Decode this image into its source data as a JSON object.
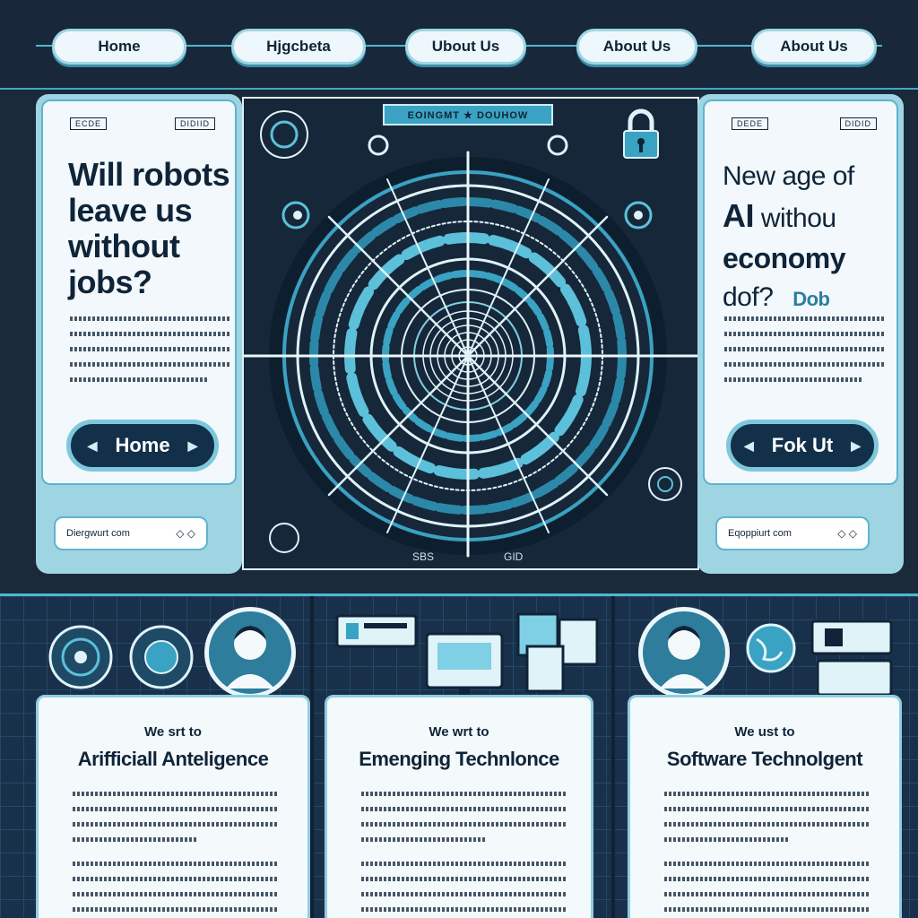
{
  "nav": {
    "items": [
      {
        "label": "Home"
      },
      {
        "label": "Hjgcbeta"
      },
      {
        "label": "Ubout Us"
      },
      {
        "label": "About Us"
      },
      {
        "label": "About Us"
      }
    ]
  },
  "left_card": {
    "tag_left": "ECDE",
    "tag_right": "DIDIID",
    "headline": "Will robots leave us without jobs?",
    "button_label": "Home",
    "email": "Diergwurt com"
  },
  "right_card": {
    "tag_left": "DEDE",
    "tag_right": "DIDID",
    "headline_line1": "New age of",
    "headline_ai": "AI",
    "headline_without": "withou",
    "headline_line3": "economy",
    "headline_line4": "dof?",
    "headline_accent": "Dob",
    "button_label": "Fok Ut",
    "email": "Eqoppiurt com"
  },
  "center": {
    "banner": "EOINGMT ★ DOUHOW",
    "label_left": "SBS",
    "label_right": "GID"
  },
  "cards": [
    {
      "subtitle": "We srt to",
      "title": "Arifficiall Anteligence"
    },
    {
      "subtitle": "We wrt to",
      "title": "Emenging Technlonce"
    },
    {
      "subtitle": "We ust to",
      "title": "Software Technolgent"
    }
  ],
  "colors": {
    "background": "#1b2a3a",
    "accent": "#3fa9c5",
    "card": "#f2f8fb",
    "button": "#13304a"
  },
  "icons": [
    "lock-icon",
    "radar-icon",
    "avatar-icon",
    "globe-icon",
    "monitor-icon",
    "chevron-left-icon",
    "chevron-right-icon"
  ]
}
